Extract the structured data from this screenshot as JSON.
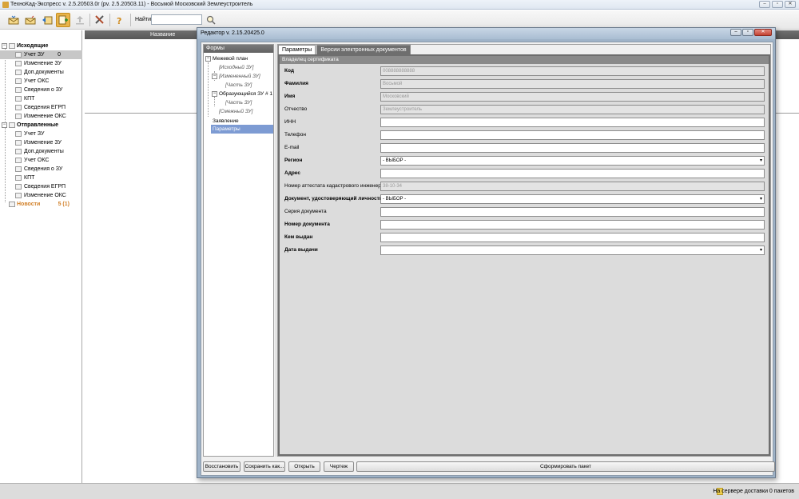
{
  "app": {
    "title": "ТехноКад-Экспресс v. 2.5.20503.0r (pv. 2.5.20503.11) - Восьмой Московский Землеустроитель"
  },
  "toolbar": {
    "find_label": "Найти",
    "find_value": "",
    "icons": [
      "inbox-icon",
      "outbox-icon",
      "reply-icon",
      "add-document-icon",
      "upload-icon",
      "tools-icon",
      "help-icon",
      "search-icon"
    ]
  },
  "tree": {
    "outgoing": {
      "label": "Исходящие",
      "items": [
        {
          "label": "Учет ЗУ",
          "count": "0"
        },
        {
          "label": "Изменение ЗУ",
          "count": ""
        },
        {
          "label": "Доп.документы",
          "count": ""
        },
        {
          "label": "Учет ОКС",
          "count": ""
        },
        {
          "label": "Сведения о ЗУ",
          "count": ""
        },
        {
          "label": "КПТ",
          "count": ""
        },
        {
          "label": "Сведения ЕГРП",
          "count": ""
        },
        {
          "label": "Изменение ОКС",
          "count": ""
        }
      ]
    },
    "sent": {
      "label": "Отправленные",
      "items": [
        {
          "label": "Учет ЗУ"
        },
        {
          "label": "Изменение ЗУ"
        },
        {
          "label": "Доп.документы"
        },
        {
          "label": "Учет ОКС"
        },
        {
          "label": "Сведения о ЗУ"
        },
        {
          "label": "КПТ"
        },
        {
          "label": "Сведения ЕГРП"
        },
        {
          "label": "Изменение ОКС"
        }
      ]
    },
    "news": {
      "label": "Новости",
      "count": "5 (1)"
    }
  },
  "list": {
    "header_name": "Название"
  },
  "status": {
    "text": "На сервере доставки 0 пакетов"
  },
  "dialog": {
    "title": "Редактор v. 2.15.20425.0",
    "forms_header": "Формы",
    "forms_tree": {
      "boundary_plan": "Межевой план",
      "source_zu": "[Исходный ЗУ]",
      "changed_zu": "[Измененный ЗУ]",
      "part_zu_1": "[Часть ЗУ]",
      "forming_zu": "Образующийся ЗУ # 1",
      "part_zu_2": "[Часть ЗУ]",
      "adjacent_zu": "[Смежный ЗУ]",
      "statement": "Заявление",
      "parameters": "Параметры"
    },
    "tabs": [
      "Параметры",
      "Версии электронных документов"
    ],
    "section_title": "Владелец сертификата",
    "fields": [
      {
        "label": "Код",
        "value": "008888888888",
        "bold": true,
        "readonly": true
      },
      {
        "label": "Фамилия",
        "value": "Восьмой",
        "bold": true,
        "readonly": true
      },
      {
        "label": "Имя",
        "value": "Московский",
        "bold": true,
        "readonly": true
      },
      {
        "label": "Отчество",
        "value": "Землеустроитель",
        "bold": false,
        "readonly": true
      },
      {
        "label": "ИНН",
        "value": "",
        "bold": false,
        "readonly": false
      },
      {
        "label": "Телефон",
        "value": "",
        "bold": false,
        "readonly": false
      },
      {
        "label": "E-mail",
        "value": "",
        "bold": false,
        "readonly": false
      },
      {
        "label": "Регион",
        "value": "- ВЫБОР -",
        "bold": true,
        "readonly": false
      },
      {
        "label": "Адрес",
        "value": "",
        "bold": true,
        "readonly": false
      },
      {
        "label": "Номер аттестата кадастрового инженера",
        "value": "38-10-34",
        "bold": false,
        "readonly": true
      },
      {
        "label": "Документ, удостоверяющий личность",
        "value": "- ВЫБОР -",
        "bold": true,
        "readonly": false
      },
      {
        "label": "Серия документа",
        "value": "",
        "bold": false,
        "readonly": false
      },
      {
        "label": "Номер документа",
        "value": "",
        "bold": true,
        "readonly": false
      },
      {
        "label": "Кем выдан",
        "value": "",
        "bold": true,
        "readonly": false
      },
      {
        "label": "Дата выдачи",
        "value": "",
        "bold": true,
        "readonly": false
      }
    ],
    "buttons": {
      "restore": "Восстановить",
      "save_as": "Сохранить как...",
      "open": "Открыть",
      "draft": "Чертеж",
      "form_package": "Сформировать пакет"
    }
  },
  "colors": {
    "accent_orange": "#e9b44a",
    "news_orange": "#d2822b",
    "selection_blue": "#7d9bd3"
  }
}
